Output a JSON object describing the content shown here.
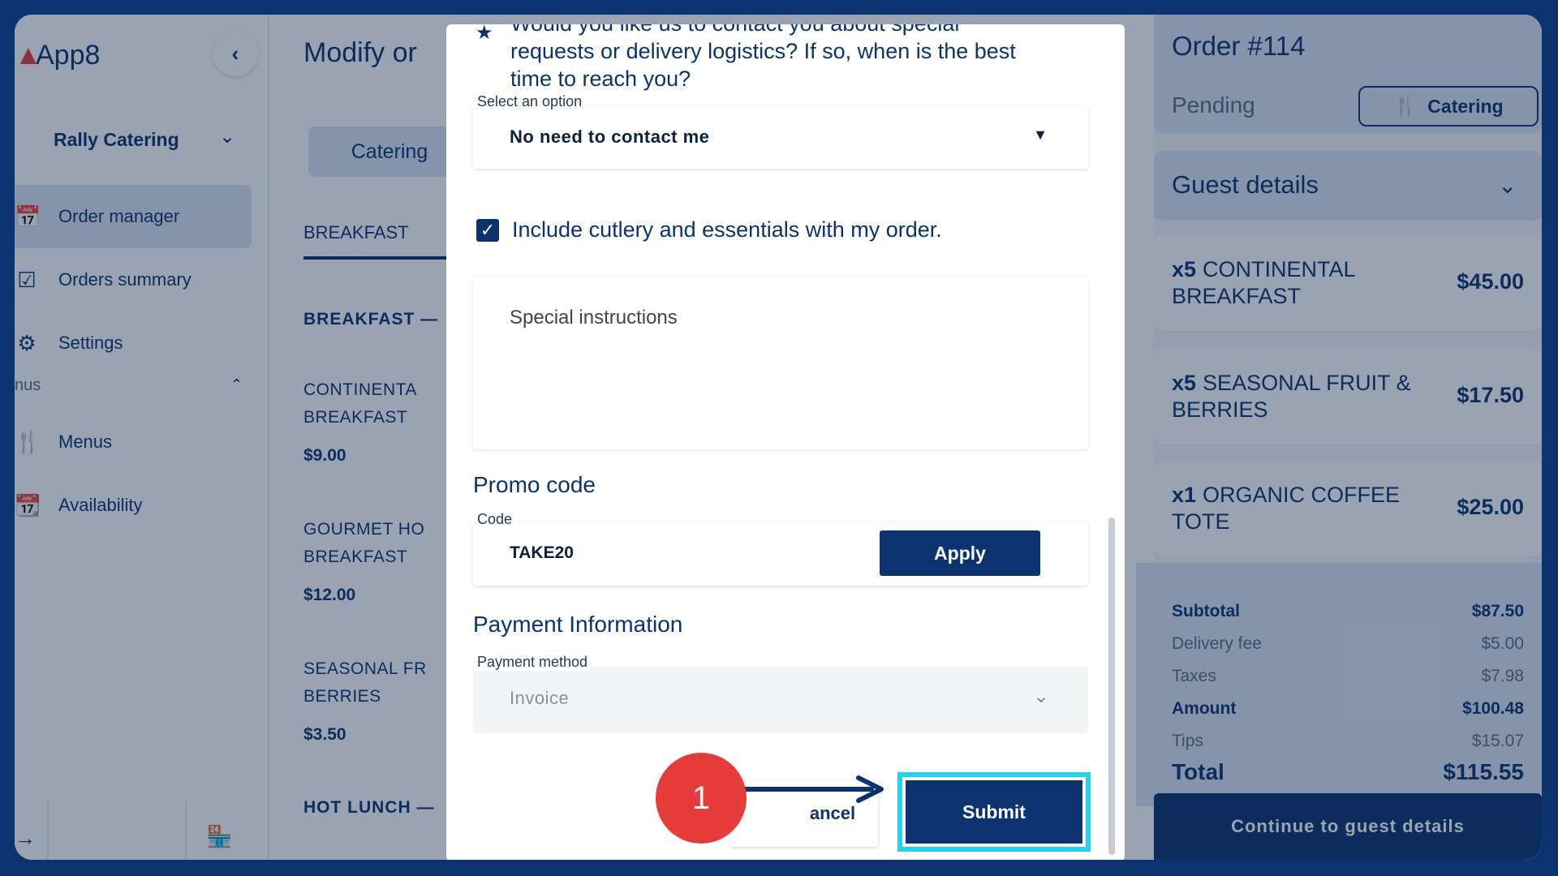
{
  "app": {
    "name": "App8"
  },
  "sidebar": {
    "store": "Rally Catering",
    "items": [
      {
        "label": "Order manager",
        "icon": "calendar-clock-icon"
      },
      {
        "label": "Orders summary",
        "icon": "clipboard-check-icon"
      },
      {
        "label": "Settings",
        "icon": "gear-icon"
      }
    ],
    "section": "nus",
    "section_items": [
      {
        "label": "Menus",
        "icon": "utensils-icon"
      },
      {
        "label": "Availability",
        "icon": "calendar-icon"
      }
    ]
  },
  "middle": {
    "title": "Modify or",
    "tab_pill": "Catering",
    "tab": "BREAKFAST",
    "categories": [
      {
        "heading": "BREAKFAST —"
      },
      {
        "heading": "HOT LUNCH —"
      }
    ],
    "items": [
      {
        "name_l1": "CONTINENTA",
        "name_l2": "BREAKFAST",
        "price": "$9.00"
      },
      {
        "name_l1": "GOURMET HO",
        "name_l2": "BREAKFAST",
        "price": "$12.00"
      },
      {
        "name_l1": "SEASONAL FR",
        "name_l2": "BERRIES",
        "price": "$3.50"
      }
    ]
  },
  "modal": {
    "question_line1": "Would you like us to contact you about special",
    "question_line2": "requests or delivery logistics? If so, when is the best",
    "question_line3": "time to reach you?",
    "select_label": "Select an option",
    "select_value": "No need to contact me",
    "checkbox_label": "Include cutlery and essentials with my order.",
    "checkbox_checked": true,
    "special_placeholder": "Special instructions",
    "promo_title": "Promo code",
    "code_label": "Code",
    "code_value": "TAKE20",
    "apply_label": "Apply",
    "payment_title": "Payment Information",
    "payment_label": "Payment method",
    "payment_value": "Invoice",
    "cancel_label": "ancel",
    "submit_label": "Submit"
  },
  "order": {
    "title": "Order #114",
    "status": "Pending",
    "type": "Catering",
    "guest_details": "Guest details",
    "items": [
      {
        "qty": "x5",
        "name_l1": "CONTINENTAL",
        "name_l2": "BREAKFAST",
        "price": "$45.00"
      },
      {
        "qty": "x5",
        "name_l1": "SEASONAL FRUIT &",
        "name_l2": "BERRIES",
        "price": "$17.50"
      },
      {
        "qty": "x1",
        "name_l1": "ORGANIC COFFEE",
        "name_l2": "TOTE",
        "price": "$25.00"
      }
    ],
    "totals": {
      "subtotal_label": "Subtotal",
      "subtotal": "$87.50",
      "delivery_label": "Delivery fee",
      "delivery": "$5.00",
      "taxes_label": "Taxes",
      "taxes": "$7.98",
      "amount_label": "Amount",
      "amount": "$100.48",
      "tips_label": "Tips",
      "tips": "$15.07",
      "total_label": "Total",
      "total": "$115.55"
    },
    "continue_label": "Continue to guest details"
  },
  "annotation": {
    "step": "1"
  },
  "colors": {
    "brand": "#0c3370",
    "highlight": "#22d3ea",
    "badge": "#e63b3b"
  }
}
